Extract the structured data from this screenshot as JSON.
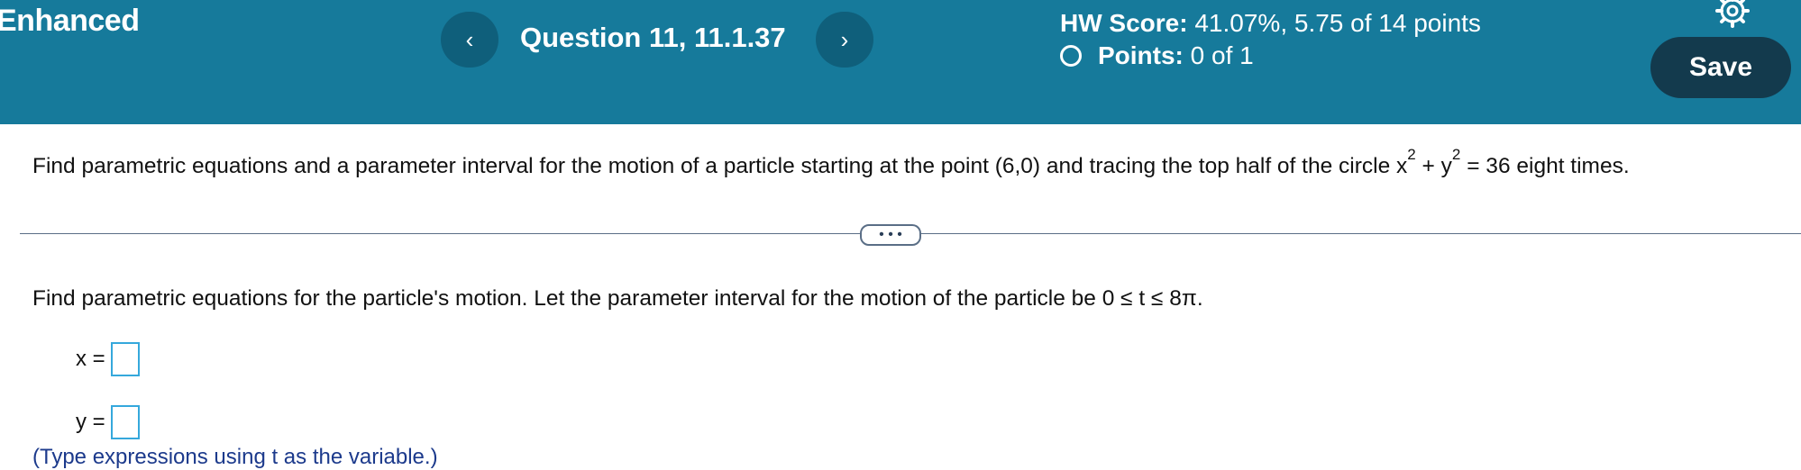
{
  "header": {
    "brand": "Enhanced",
    "question_title": "Question 11, 11.1.37",
    "prev_label": "‹",
    "next_label": "›",
    "hw_score_label": "HW Score:",
    "hw_score_value": "41.07%, 5.75 of 14 points",
    "points_label": "Points:",
    "points_value": "0 of 1",
    "save_label": "Save",
    "settings_icon": "gear-icon"
  },
  "problem": {
    "prompt_before": "Find parametric equations and a parameter interval for the motion of a particle starting at the point (6,0) and tracing the top half of the circle x",
    "exp1": "2",
    "plus_y": " + y",
    "exp2": "2",
    "prompt_after": " = 36 eight times.",
    "more_label": "• • •",
    "instruction": "Find parametric equations for the particle's motion. Let the parameter interval for the motion of the particle be 0 ≤ t ≤ 8π.",
    "x_label": "x =",
    "y_label": "y =",
    "x_value": "",
    "y_value": "",
    "hint": "(Type expressions using t as the variable.)"
  },
  "colors": {
    "header_bg": "#167a9b",
    "nav_button_bg": "#0f5f7b",
    "save_button_bg": "#133a4d",
    "answer_box_border": "#35a8dc"
  }
}
